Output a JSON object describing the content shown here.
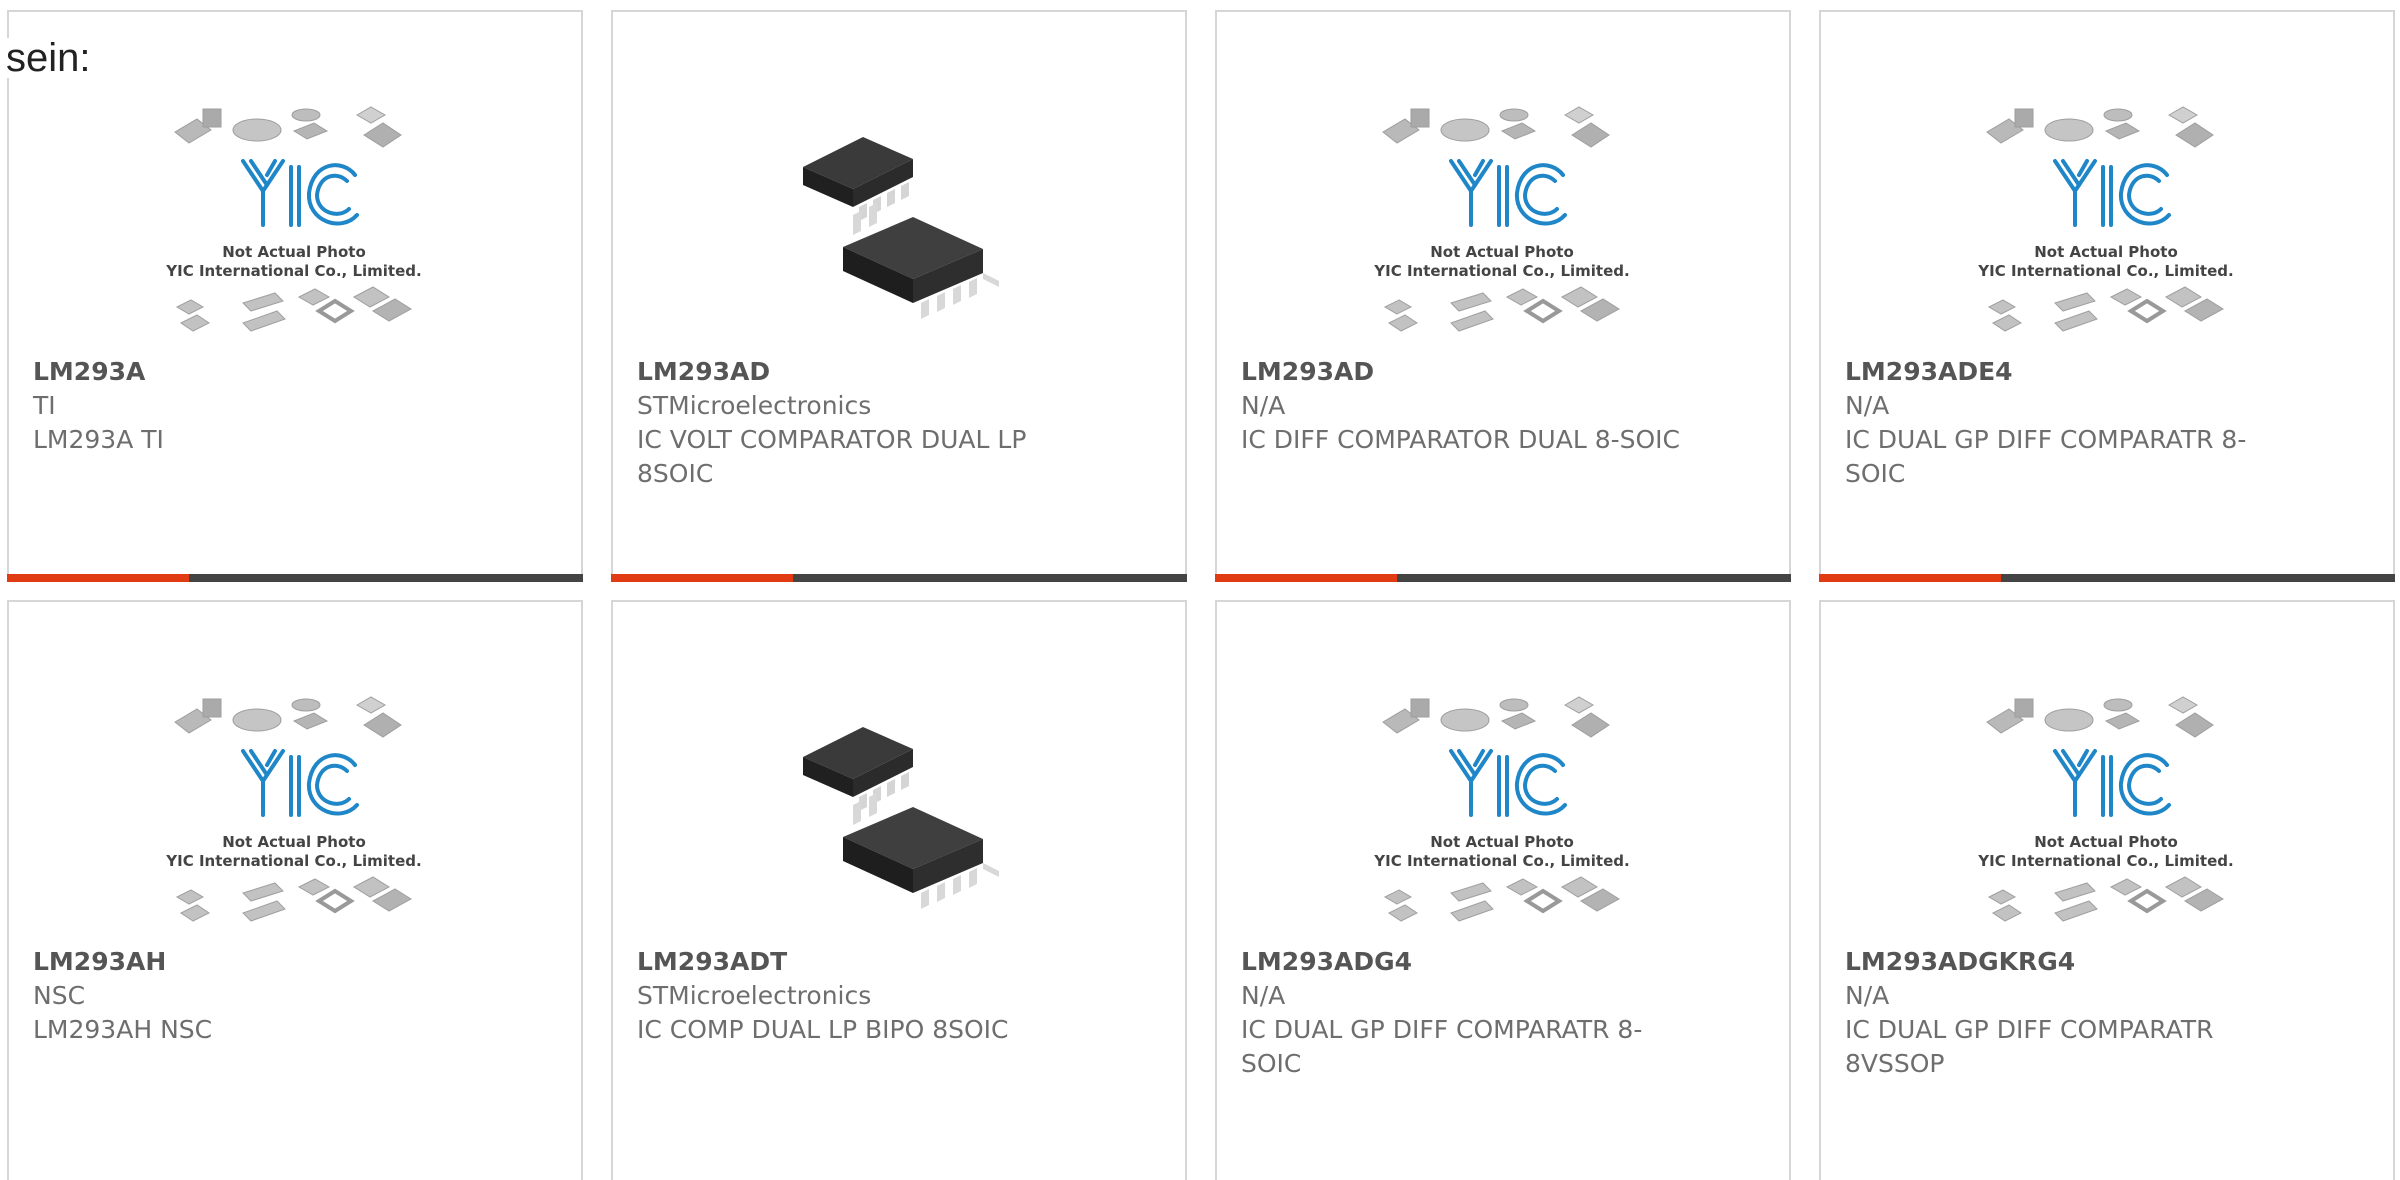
{
  "intro_text": "sein:",
  "placeholder": {
    "line1": "Not Actual Photo",
    "line2": "YIC International Co., Limited."
  },
  "colors": {
    "accent_red": "#e13b14",
    "accent_dark": "#444444",
    "logo_blue": "#1f86c8",
    "border": "#d6d6d6"
  },
  "products": [
    {
      "part": "LM293A",
      "maker": "TI",
      "desc": "LM293A TI",
      "image": "yic-placeholder"
    },
    {
      "part": "LM293AD",
      "maker": "STMicroelectronics",
      "desc": "IC VOLT COMPARATOR DUAL LP 8SOIC",
      "image": "soic8-chip"
    },
    {
      "part": "LM293AD",
      "maker": "N/A",
      "desc": "IC DIFF COMPARATOR DUAL 8-SOIC",
      "image": "yic-placeholder"
    },
    {
      "part": "LM293ADE4",
      "maker": "N/A",
      "desc": "IC DUAL GP DIFF COMPARATR 8-SOIC",
      "image": "yic-placeholder"
    },
    {
      "part": "LM293AH",
      "maker": "NSC",
      "desc": "LM293AH NSC",
      "image": "yic-placeholder"
    },
    {
      "part": "LM293ADT",
      "maker": "STMicroelectronics",
      "desc": "IC COMP DUAL LP BIPO 8SOIC",
      "image": "soic8-chip"
    },
    {
      "part": "LM293ADG4",
      "maker": "N/A",
      "desc": "IC DUAL GP DIFF COMPARATR 8-SOIC",
      "image": "yic-placeholder"
    },
    {
      "part": "LM293ADGKRG4",
      "maker": "N/A",
      "desc": "IC DUAL GP DIFF COMPARATR 8VSSOP",
      "image": "yic-placeholder"
    }
  ]
}
